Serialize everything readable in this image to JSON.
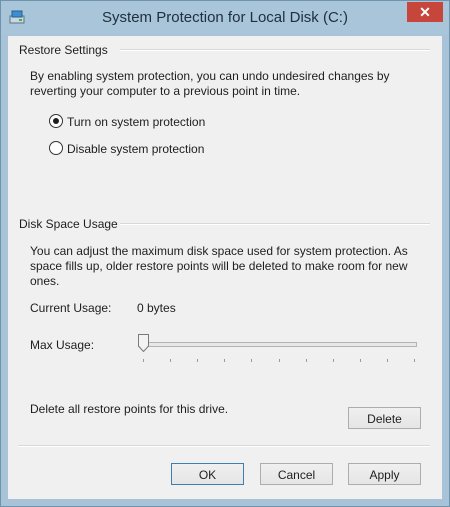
{
  "window": {
    "title": "System Protection for Local Disk (C:)",
    "close_glyph": "✕"
  },
  "restore_settings": {
    "header": "Restore Settings",
    "description_line1": "By enabling system protection, you can undo undesired changes by",
    "description_line2": "reverting your computer to a previous point in time.",
    "options": [
      {
        "label": "Turn on system protection",
        "selected": true
      },
      {
        "label": "Disable system protection",
        "selected": false
      }
    ]
  },
  "disk_space": {
    "header": "Disk Space Usage",
    "description_line1": "You can adjust the maximum disk space used for system protection. As",
    "description_line2": "space fills up, older restore points will be deleted to make room for new",
    "description_line3": "ones.",
    "current_usage_label": "Current Usage:",
    "current_usage_value": "0 bytes",
    "max_usage_label": "Max Usage:",
    "max_usage_fraction": 0.0
  },
  "delete_section": {
    "text": "Delete all restore points for this drive.",
    "button": "Delete"
  },
  "footer": {
    "ok": "OK",
    "cancel": "Cancel",
    "apply": "Apply"
  },
  "colors": {
    "window_frame": "#a9c5da",
    "close_button": "#c7463b",
    "dialog_bg": "#f0f0f0"
  }
}
